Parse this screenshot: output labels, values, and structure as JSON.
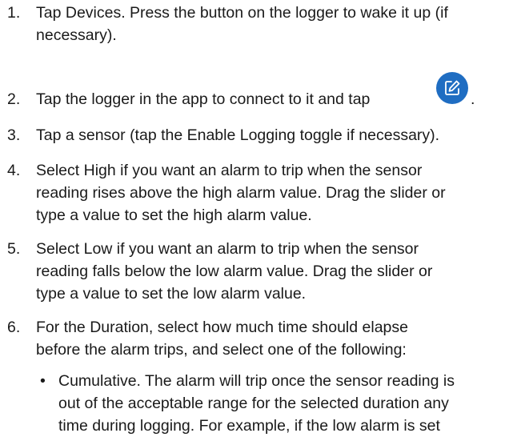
{
  "steps": [
    {
      "number": "1.",
      "lines": [
        "Tap Devices. Press the button on the logger to wake it up (if",
        "necessary)."
      ]
    },
    {
      "number": "2.",
      "text_before_icon": "Tap the logger in the app to connect to it and tap",
      "text_after_icon": ".",
      "icon": "edit-pencil-icon",
      "icon_color": "#1f6dc2"
    },
    {
      "number": "3.",
      "lines": [
        "Tap a sensor (tap the Enable Logging toggle if necessary)."
      ]
    },
    {
      "number": "4.",
      "lines": [
        "Select High if you want an alarm to trip when the sensor",
        "reading rises above the high alarm value. Drag the slider or",
        "type a value to set the high alarm value."
      ]
    },
    {
      "number": "5.",
      "lines": [
        "Select Low if you want an alarm to trip when the sensor",
        "reading falls below the low alarm value. Drag the slider or",
        "type a value to set the low alarm value."
      ]
    },
    {
      "number": "6.",
      "lines": [
        "For the Duration, select how much time should elapse",
        "before the alarm trips, and select one of the following:"
      ]
    }
  ],
  "bullets": [
    {
      "marker": "•",
      "lines": [
        "Cumulative. The alarm will trip once the sensor reading is",
        "out of the acceptable range for the selected duration any",
        "time during logging. For example, if the low alarm is set"
      ]
    }
  ]
}
